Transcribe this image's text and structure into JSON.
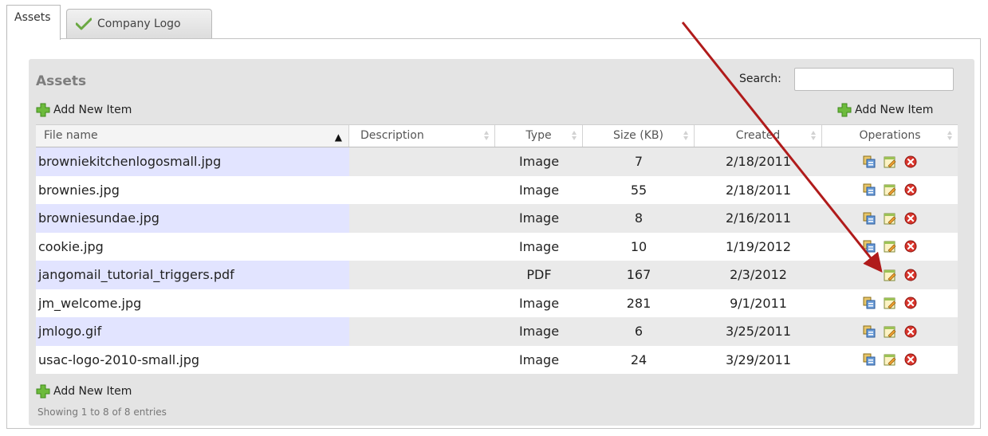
{
  "tabs": [
    {
      "label": "Assets",
      "active": true
    },
    {
      "label": "Company Logo",
      "icon": "checkmark-icon",
      "active": false
    }
  ],
  "section": {
    "title": "Assets"
  },
  "search": {
    "label": "Search:",
    "value": ""
  },
  "actions": {
    "add_new_item": "Add New Item"
  },
  "table": {
    "columns": [
      "File name",
      "Description",
      "Type",
      "Size (KB)",
      "Created",
      "Operations"
    ],
    "sorted_column": "File name",
    "sort_direction": "ascending",
    "rows": [
      {
        "name": "browniekitchenlogosmall.jpg",
        "description": "",
        "type": "Image",
        "size": "7",
        "created": "2/18/2011",
        "ops": [
          "copy-icon",
          "edit-icon",
          "delete-icon"
        ]
      },
      {
        "name": "brownies.jpg",
        "description": "",
        "type": "Image",
        "size": "55",
        "created": "2/18/2011",
        "ops": [
          "copy-icon",
          "edit-icon",
          "delete-icon"
        ]
      },
      {
        "name": "browniesundae.jpg",
        "description": "",
        "type": "Image",
        "size": "8",
        "created": "2/16/2011",
        "ops": [
          "copy-icon",
          "edit-icon",
          "delete-icon"
        ]
      },
      {
        "name": "cookie.jpg",
        "description": "",
        "type": "Image",
        "size": "10",
        "created": "1/19/2012",
        "ops": [
          "copy-icon",
          "edit-icon",
          "delete-icon"
        ]
      },
      {
        "name": "jangomail_tutorial_triggers.pdf",
        "description": "",
        "type": "PDF",
        "size": "167",
        "created": "2/3/2012",
        "ops": [
          "edit-icon",
          "delete-icon"
        ]
      },
      {
        "name": "jm_welcome.jpg",
        "description": "",
        "type": "Image",
        "size": "281",
        "created": "9/1/2011",
        "ops": [
          "copy-icon",
          "edit-icon",
          "delete-icon"
        ]
      },
      {
        "name": "jmlogo.gif",
        "description": "",
        "type": "Image",
        "size": "6",
        "created": "3/25/2011",
        "ops": [
          "copy-icon",
          "edit-icon",
          "delete-icon"
        ]
      },
      {
        "name": "usac-logo-2010-small.jpg",
        "description": "",
        "type": "Image",
        "size": "24",
        "created": "3/29/2011",
        "ops": [
          "copy-icon",
          "edit-icon",
          "delete-icon"
        ]
      }
    ]
  },
  "footer": {
    "info": "Showing 1 to 8 of 8 entries"
  },
  "colors": {
    "odd_row": "#e2e4ff",
    "even_row": "#ffffff",
    "grey_row": "#eaeaea",
    "arrow": "#b01b1b"
  }
}
